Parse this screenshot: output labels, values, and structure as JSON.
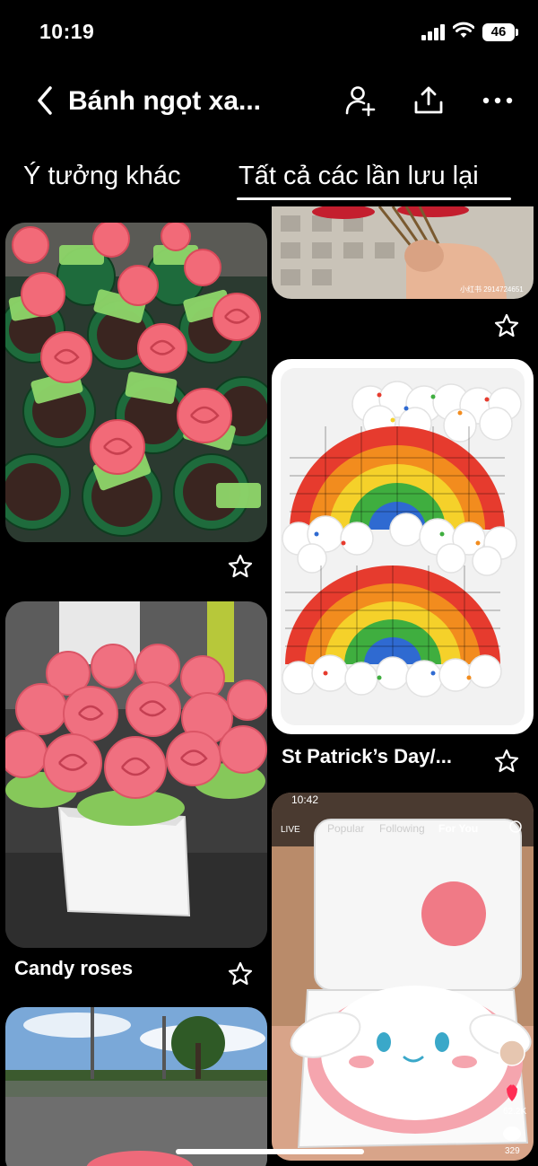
{
  "status": {
    "time": "10:19",
    "battery": "46"
  },
  "header": {
    "title": "Bánh ngọt xa..."
  },
  "tabs": [
    {
      "label": "Ý tưởng khác",
      "active": false
    },
    {
      "label": "Tất cả các lần lưu lại",
      "active": true
    }
  ],
  "pins": [
    {
      "caption": "",
      "image": "rose-sour-candy-cupcakes"
    },
    {
      "caption": "Candy roses",
      "image": "candy-roses-bouquet-in-white-pot"
    },
    {
      "caption": "",
      "image": "outdoor-parking-lot-with-candy"
    },
    {
      "caption": "",
      "image": "hand-holding-candy-skewers",
      "watermark": "小红书 2914724651"
    },
    {
      "caption": "St Patrick’s Day/...",
      "image": "rainbow-waffles-with-whipped-cream"
    },
    {
      "caption": "",
      "image": "tiktok-bento-cake-screenshot",
      "overlay": {
        "time": "10:42",
        "live": "LIVE",
        "tab_popular": "Popular",
        "tab_following": "Following",
        "tab_foryou": "For You",
        "likes": "62.2K",
        "comments": "329"
      }
    }
  ],
  "colors": {
    "background": "#000000",
    "text": "#ffffff",
    "accent_like": "#ff2d55"
  }
}
